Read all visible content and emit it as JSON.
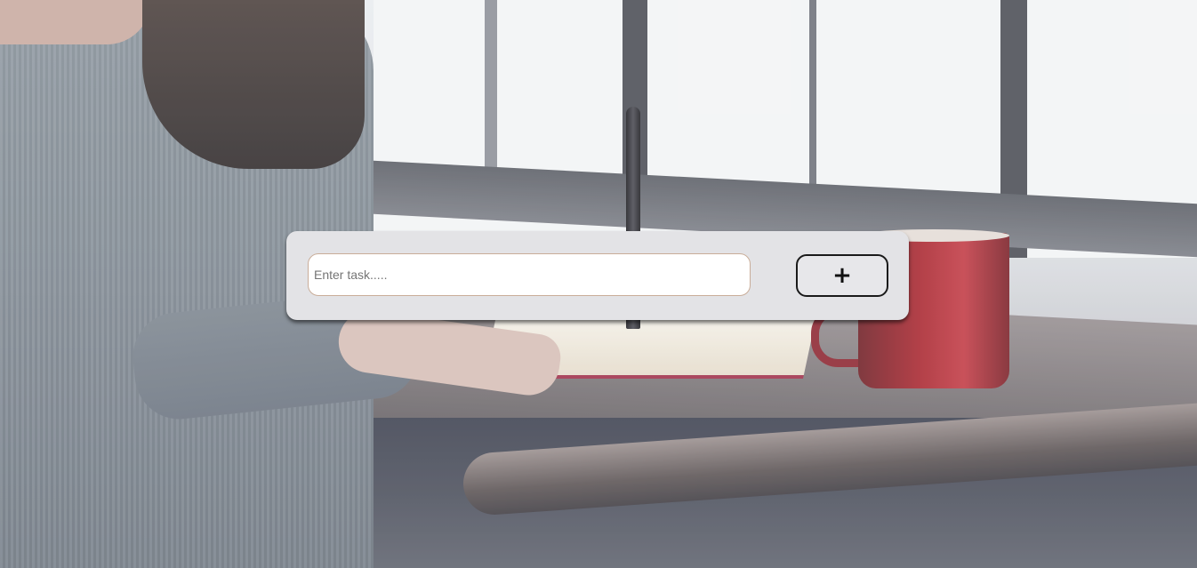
{
  "background": {
    "description_icon": "photo-background"
  },
  "task_form": {
    "input_value": "",
    "input_placeholder": "Enter task.....",
    "add_button_label": "+"
  }
}
